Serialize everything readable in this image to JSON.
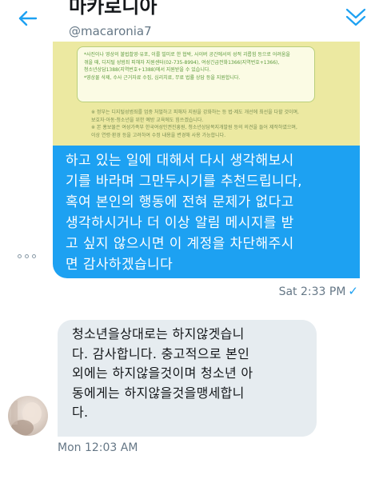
{
  "header": {
    "title": "마카로니아",
    "handle": "@macaronia7",
    "back_icon": "back-arrow-icon",
    "menu_icon": "chevron-down-icon",
    "accent": "#1da1f2"
  },
  "attachment": {
    "box_lines": [
      "*사진이나 영상의 불법촬영·유포, 이를 빌미로 한 협박, 사이버 공간에서의 성적 괴롭힘 등으로 어려움을",
      "겪을 때, 디지털 성범죄 피해자 지원센터(02-735-8994), 여성긴급전화1366(지역번호+1366),",
      "청소년상담1388(지역번호+1388)에서 지원받을 수 있습니다.",
      "*영상물 삭제, 수사 근거자료 수집, 심리치료, 무료 법률 상담 등을 지원합니다."
    ],
    "notes": [
      "※ 정부는 디지털성범죄를 엄중 처벌하고 피해자 지원을 강화하는 등 법·제도 개선에 최선을 다할 것이며,",
      "보호자·아동·청소년을 위한 예방 교육에도 힘쓰겠습니다.",
      "※ 본 홍보물은 여성가족부 한국여성인권진흥원, 청소년상담복지개발원 등의 의견을 들어 제작하였으며,",
      "이상 연령·환경 등을 고려하여 수정 내용을 변경해 사용 가능합니다."
    ]
  },
  "sent_message": {
    "lines": [
      "하고 있는 일에 대해서 다시 생각해보시",
      "기를 바라며 그만두시기를 추천드립니다,",
      "혹여 본인의 행동에 전혀 문제가 없다고",
      "생각하시거나 더 이상 알림 메시지를 받",
      "고 싶지 않으시면 이 계정을 차단해주시",
      "면 감사하겠습니다"
    ],
    "timestamp": "Sat 2:33 PM",
    "status_icon": "check-icon",
    "more_icon": "more-options-icon"
  },
  "received_message": {
    "lines": [
      "청소년을상대로는 하지않겟습니",
      "다. 감사합니다. 충고적으로 본인",
      "외에는 하지않을것이며 청소년 아",
      "동에게는 하지않을것을맹세합니",
      "다."
    ],
    "timestamp": "Mon 12:03 AM",
    "avatar_icon": "avatar"
  }
}
